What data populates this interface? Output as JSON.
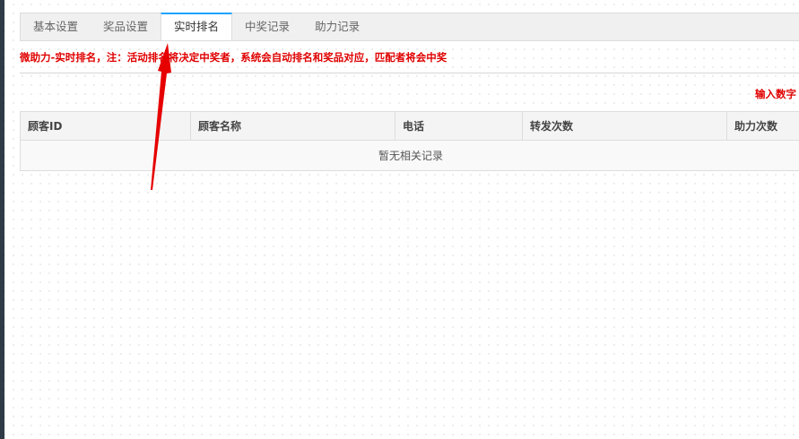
{
  "tabs": [
    {
      "label": "基本设置",
      "active": false
    },
    {
      "label": "奖品设置",
      "active": false
    },
    {
      "label": "实时排名",
      "active": true
    },
    {
      "label": "中奖记录",
      "active": false
    },
    {
      "label": "助力记录",
      "active": false
    }
  ],
  "notice": "微助力-实时排名，注：活动排名将决定中奖者，系统会自动排名和奖品对应，匹配者将会中奖",
  "hint": "输入数字",
  "table": {
    "columns": [
      "顾客ID",
      "顾客名称",
      "电话",
      "转发次数",
      "助力次数"
    ],
    "empty_text": "暂无相关记录"
  },
  "colors": {
    "accent_tab_border": "#1aa3ff",
    "notice_text": "#e00000",
    "annotation_arrow": "#e60000"
  },
  "icons": {
    "annotation": "red-arrow-icon"
  }
}
